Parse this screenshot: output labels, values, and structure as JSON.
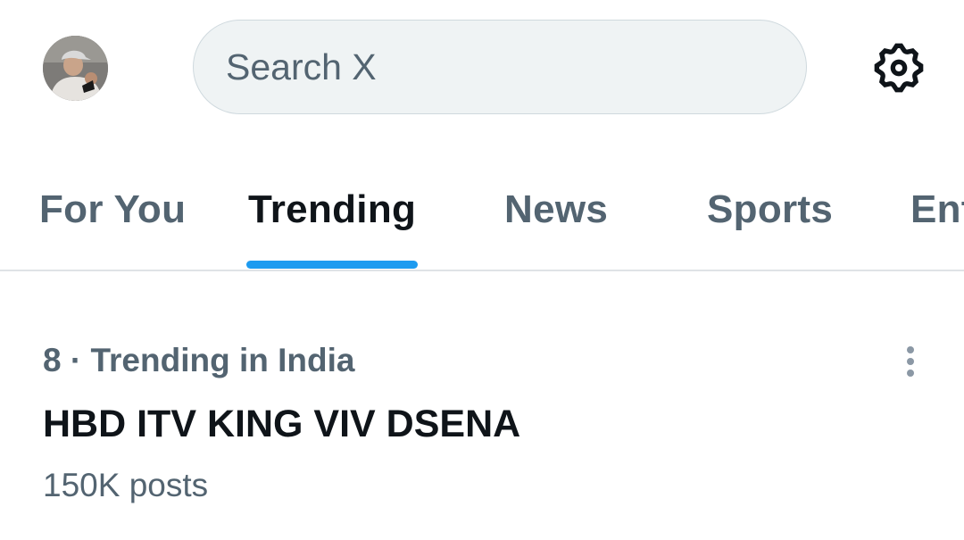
{
  "header": {
    "avatar_icon": "profile-avatar",
    "search": {
      "placeholder": "Search X",
      "value": ""
    },
    "settings_icon": "gear-icon"
  },
  "tabs": [
    {
      "label": "For You",
      "active": false
    },
    {
      "label": "Trending",
      "active": true
    },
    {
      "label": "News",
      "active": false
    },
    {
      "label": "Sports",
      "active": false
    },
    {
      "label": "Ent",
      "active": false
    }
  ],
  "trend": {
    "context": "8 · Trending in India",
    "title": "HBD ITV KING VIV DSENA",
    "posts": "150K posts",
    "more_icon": "more-vertical-icon"
  },
  "colors": {
    "accent": "#1d9bf0",
    "text_primary": "#0f1419",
    "text_secondary": "#536471",
    "search_bg": "#eff3f4"
  }
}
